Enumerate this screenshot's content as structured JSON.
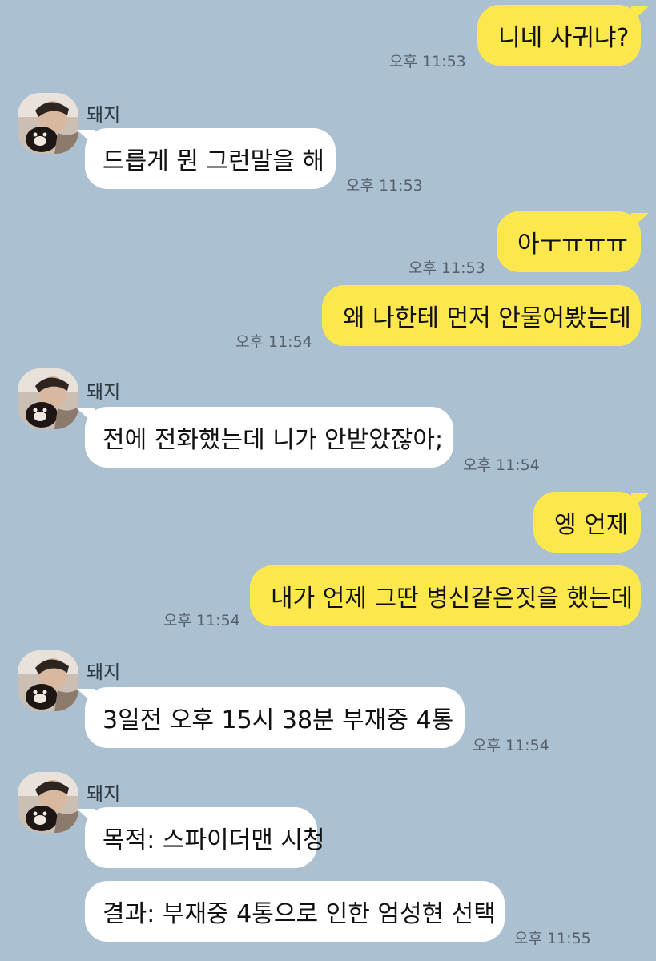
{
  "contact": {
    "name": "돼지"
  },
  "colors": {
    "background": "#abc1d1",
    "my_bubble": "#fce84c",
    "their_bubble": "#ffffff"
  },
  "messages": [
    {
      "sender": "me",
      "text": "니네 사귀냐?",
      "time": "오후 11:53"
    },
    {
      "sender": "them",
      "text": "드릅게 뭔 그런말을 해",
      "time": "오후 11:53"
    },
    {
      "sender": "me",
      "text": "아ㅜㅠㅠㅠ",
      "time": "오후 11:53"
    },
    {
      "sender": "me",
      "text": "왜 나한테 먼저 안물어봤는데",
      "time": "오후 11:54"
    },
    {
      "sender": "them",
      "text": "전에 전화했는데 니가 안받았잖아;",
      "time": "오후 11:54"
    },
    {
      "sender": "me",
      "text": "엥 언제",
      "time": ""
    },
    {
      "sender": "me",
      "text": "내가 언제 그딴 병신같은짓을 했는데",
      "time": "오후 11:54"
    },
    {
      "sender": "them",
      "text": "3일전 오후 15시 38분 부재중 4통",
      "time": "오후 11:54"
    },
    {
      "sender": "them",
      "text": "목적: 스파이더맨 시청",
      "time": ""
    },
    {
      "sender": "them",
      "text": "결과: 부재중 4통으로 인한 엄성현 선택",
      "time": "오후 11:55"
    }
  ]
}
